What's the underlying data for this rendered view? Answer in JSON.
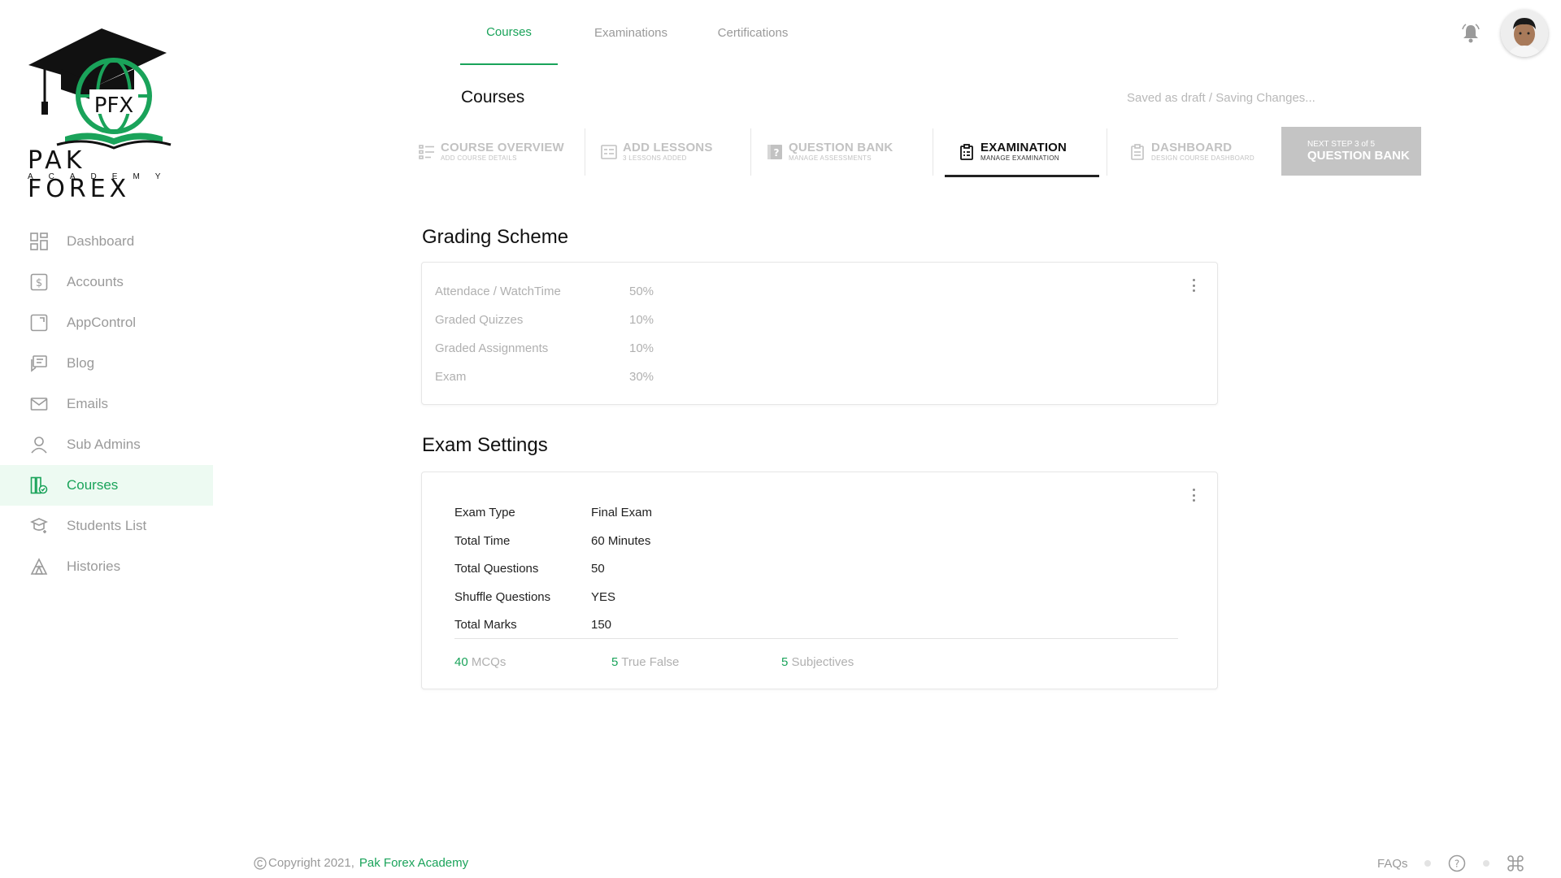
{
  "brand": {
    "logo_text": "PAK FOREX",
    "logo_sub": "ACADEMY",
    "logo_mark": "PFX"
  },
  "sidebar": {
    "items": [
      {
        "label": "Dashboard",
        "icon": "dashboard-icon"
      },
      {
        "label": "Accounts",
        "icon": "dollar-icon"
      },
      {
        "label": "AppControl",
        "icon": "app-control-icon"
      },
      {
        "label": "Blog",
        "icon": "blog-icon"
      },
      {
        "label": "Emails",
        "icon": "email-icon"
      },
      {
        "label": "Sub Admins",
        "icon": "user-icon"
      },
      {
        "label": "Courses",
        "icon": "courses-icon",
        "active": true
      },
      {
        "label": "Students List",
        "icon": "students-icon"
      },
      {
        "label": "Histories",
        "icon": "histories-icon"
      }
    ]
  },
  "topnav": {
    "tabs": [
      {
        "label": "Courses",
        "active": true
      },
      {
        "label": "Examinations"
      },
      {
        "label": "Certifications"
      }
    ]
  },
  "header": {
    "title": "Courses",
    "save_status": "Saved as draft / Saving Changes..."
  },
  "steps": [
    {
      "title": "COURSE OVERVIEW",
      "subtitle": "ADD COURSE DETAILS"
    },
    {
      "title": "ADD LESSONS",
      "subtitle": "3 LESSONS ADDED"
    },
    {
      "title": "QUESTION BANK",
      "subtitle": "MANAGE ASSESSMENTS"
    },
    {
      "title": "EXAMINATION",
      "subtitle": "MANAGE EXAMINATION",
      "active": true
    },
    {
      "title": "DASHBOARD",
      "subtitle": "DESIGN COURSE DASHBOARD"
    }
  ],
  "next_step": {
    "label": "NEXT STEP 3 of 5",
    "title": "QUESTION BANK"
  },
  "grading": {
    "title": "Grading Scheme",
    "rows": [
      {
        "label": "Attendace / WatchTime",
        "value": "50%"
      },
      {
        "label": "Graded Quizzes",
        "value": "10%"
      },
      {
        "label": "Graded Assignments",
        "value": "10%"
      },
      {
        "label": "Exam",
        "value": "30%"
      }
    ]
  },
  "exam": {
    "title": "Exam Settings",
    "rows": [
      {
        "label": "Exam Type",
        "value": "Final Exam"
      },
      {
        "label": "Total Time",
        "value": "60 Minutes"
      },
      {
        "label": "Total Questions",
        "value": "50"
      },
      {
        "label": "Shuffle Questions",
        "value": "YES"
      },
      {
        "label": "Total Marks",
        "value": "150"
      }
    ],
    "counts": [
      {
        "num": "40",
        "label": "MCQs"
      },
      {
        "num": "5",
        "label": "True False"
      },
      {
        "num": "5",
        "label": "Subjectives"
      }
    ]
  },
  "footer": {
    "copyright": "Copyright 2021,",
    "brand": "Pak Forex Academy",
    "faq": "FAQs"
  },
  "colors": {
    "accent": "#1aa35a",
    "muted": "#9a9a9a",
    "next_step_bg": "#c4c4c4"
  }
}
